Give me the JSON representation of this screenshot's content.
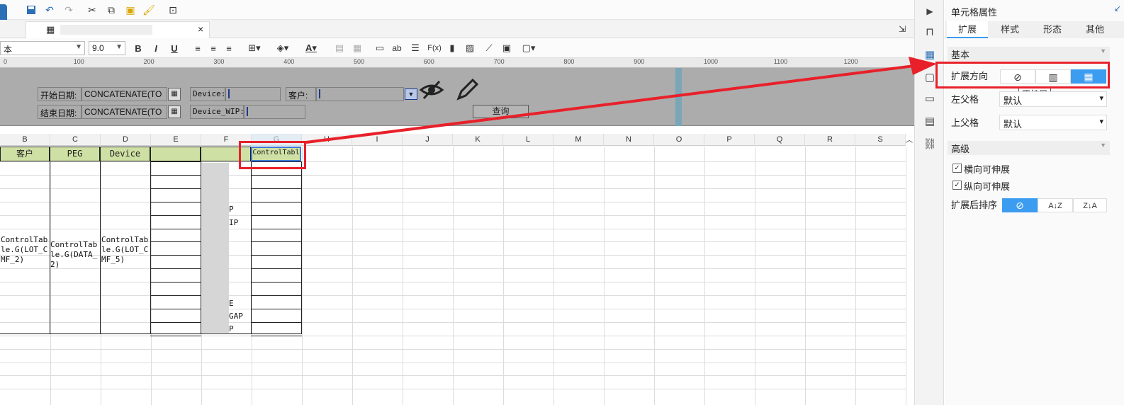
{
  "toolbar": {
    "icons": [
      "save-icon",
      "undo-icon",
      "redo-icon",
      "cut-icon",
      "copy-icon",
      "paste-icon",
      "format-brush-icon",
      "preview-icon"
    ]
  },
  "tab": {
    "title": "",
    "close": "×"
  },
  "format_bar": {
    "font_name": "本",
    "font_size": "9.0",
    "bold": "B",
    "italic": "I",
    "underline": "U",
    "fx_label": "F(x)",
    "ab_label": "ab"
  },
  "ruler": {
    "ticks": [
      "0",
      "100",
      "200",
      "300",
      "400",
      "500",
      "600",
      "700",
      "800",
      "900",
      "1000",
      "1100",
      "1200"
    ]
  },
  "params": {
    "start_date_label": "开始日期:",
    "start_date_value": "CONCATENATE(TO",
    "end_date_label": "结束日期:",
    "end_date_value": "CONCATENATE(TO",
    "device_label": "Device:",
    "device_wip_label": "Device_WIP:",
    "customer_label": "客户:",
    "query_button": "查询"
  },
  "grid": {
    "columns": [
      "B",
      "C",
      "D",
      "E",
      "F",
      "G",
      "H",
      "I",
      "J",
      "K",
      "L",
      "M",
      "N",
      "O",
      "P",
      "Q",
      "R",
      "S"
    ],
    "header_cells": [
      "客户",
      "PEG",
      "Device",
      "",
      "",
      "ControlTabl"
    ],
    "b_cell": "ControlTable.G(LOT_CMF_2)",
    "c_cell": "ControlTable.G(DATA_2)",
    "d_cell": "ControlTable.G(LOT_CMF_5)",
    "f_fragments": [
      "P",
      "IP",
      "E",
      "GAP",
      "P"
    ]
  },
  "panel": {
    "title": "单元格属性",
    "tabs": [
      "扩展",
      "样式",
      "形态",
      "其他"
    ],
    "basic_section": "基本",
    "expand_dir_label": "扩展方向",
    "tooltip": "不扩展",
    "left_parent_label": "左父格",
    "left_parent_value": "默认",
    "top_parent_label": "上父格",
    "top_parent_value": "默认",
    "advanced_section": "高级",
    "horizontal_expand": "横向可伸展",
    "vertical_expand": "纵向可伸展",
    "sort_after_label": "扩展后排序"
  },
  "colors": {
    "accent": "#3c9cf0",
    "highlight_red": "#e8202a",
    "header_green": "#cfe0a4"
  }
}
